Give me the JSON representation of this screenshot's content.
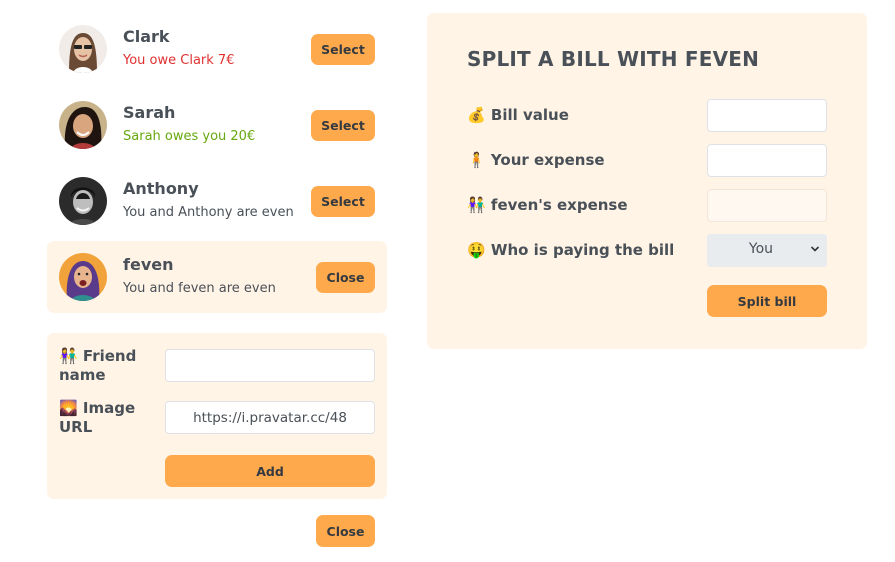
{
  "friends": [
    {
      "name": "Clark",
      "status": "You owe Clark 7€",
      "button": "Select"
    },
    {
      "name": "Sarah",
      "status": "Sarah owes you 20€",
      "button": "Select"
    },
    {
      "name": "Anthony",
      "status": "You and Anthony are even",
      "button": "Select"
    },
    {
      "name": "feven",
      "status": "You and feven are even",
      "button": "Close"
    }
  ],
  "colors": {
    "accent": "#ffa94d",
    "panel": "#fff4e6",
    "owe_red": "#e03131",
    "owed_green": "#66a80f"
  },
  "add_form": {
    "name_icon": "👫",
    "name_label": "Friend name",
    "name_value": "",
    "image_icon": "🌄",
    "image_label": "Image URL",
    "image_value": "https://i.pravatar.cc/48",
    "add_label": "Add"
  },
  "close_label": "Close",
  "split": {
    "title": "SPLIT A BILL WITH FEVEN",
    "bill_icon": "💰",
    "bill_label": "Bill value",
    "bill_value": "",
    "expense_icon": "🧍",
    "expense_label": "Your expense",
    "expense_value": "",
    "friend_icon": "👫",
    "friend_label": "feven's expense",
    "friend_value": "",
    "payer_icon": "🤑",
    "payer_label": "Who is paying the bill",
    "payer_value": "You",
    "submit_label": "Split bill"
  }
}
